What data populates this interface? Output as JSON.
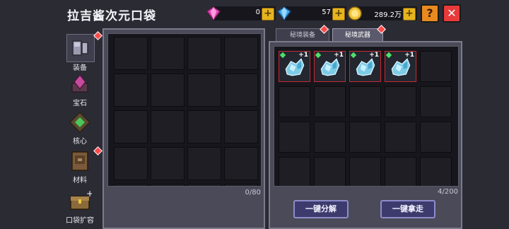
{
  "header": {
    "title": "拉吉酱次元口袋",
    "pink_gems": "0",
    "blue_gems": "57",
    "gold": "289.2万",
    "help_label": "?",
    "close_label": "✕"
  },
  "sidebar": {
    "items": [
      {
        "label": "装备",
        "icon": "armor-icon",
        "active": true,
        "badge": true
      },
      {
        "label": "宝石",
        "icon": "gem-icon",
        "active": false,
        "badge": false
      },
      {
        "label": "核心",
        "icon": "core-icon",
        "active": false,
        "badge": false
      },
      {
        "label": "材料",
        "icon": "material-icon",
        "active": false,
        "badge": true
      },
      {
        "label": "口袋扩容",
        "icon": "chest-icon",
        "active": false,
        "badge": false
      }
    ]
  },
  "pocket": {
    "count": "0/80"
  },
  "tabs": [
    {
      "label": "秘境装备",
      "active": false,
      "badge": true
    },
    {
      "label": "秘境武器",
      "active": true,
      "badge": true
    }
  ],
  "inventory": {
    "count": "4/200",
    "items": [
      {
        "level": "+1"
      },
      {
        "level": "+1"
      },
      {
        "level": "+1"
      },
      {
        "level": "+1"
      }
    ]
  },
  "actions": {
    "disassemble": "一键分解",
    "take_all": "一键拿走"
  },
  "colors": {
    "accent_gold": "#e6b41e",
    "close_red": "#e83a3a",
    "help_orange": "#e88a20",
    "item_border": "#c32a34"
  }
}
